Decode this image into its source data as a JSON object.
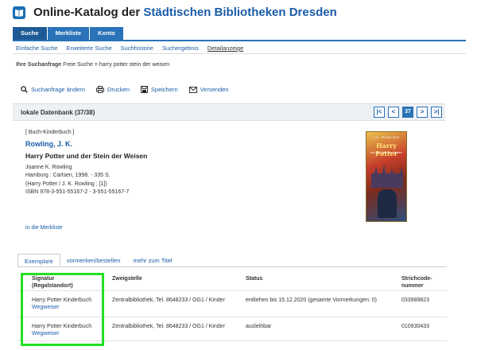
{
  "header": {
    "title_prefix": "Online-Katalog der",
    "title_accent": "Städtischen Bibliotheken Dresden",
    "logo_icon": "book-icon"
  },
  "main_tabs": [
    {
      "label": "Suche",
      "active": true
    },
    {
      "label": "Merkliste",
      "active": false
    },
    {
      "label": "Konto",
      "active": false
    }
  ],
  "sub_nav": [
    {
      "label": "Einfache Suche",
      "active": false
    },
    {
      "label": "Erweiterte Suche",
      "active": false
    },
    {
      "label": "Suchhistorie",
      "active": false
    },
    {
      "label": "Suchergebnis",
      "active": false
    },
    {
      "label": "Detailanzeige",
      "active": true
    }
  ],
  "query": {
    "label": "Ihre Suchanfrage",
    "value": "Freie Suche = harry potter stein der weisen"
  },
  "actions": [
    {
      "label": "Suchanfrage ändern",
      "icon": "search-icon"
    },
    {
      "label": "Drucken",
      "icon": "print-icon"
    },
    {
      "label": "Speichern",
      "icon": "save-icon"
    },
    {
      "label": "Versenden",
      "icon": "mail-icon"
    }
  ],
  "result_bar": {
    "count_label": "lokale Datenbank (37/38)",
    "current_page": "37",
    "pager_icons": [
      "first-page-icon",
      "prev-page-icon",
      "next-page-icon",
      "last-page-icon"
    ]
  },
  "record": {
    "type": "[ Buch-Kinderbuch ]",
    "author": "Rowling, J. K.",
    "title": "Harry Potter und der Stein der Weisen",
    "statement": "Joanne K. Rowling",
    "publication": "Hamburg : Carlsen, 1998. - 335 S.",
    "series": "(Harry Potter / J. K. Rowling ; [1])",
    "isbn": "ISBN 978-3-551-55167-2 - 3-551-55167-7",
    "merkliste_link": "in die Merkliste"
  },
  "cover": {
    "author": "J.K. ROWLING",
    "title": "Harry Potter",
    "subtitle": "und der Stein der Weisen"
  },
  "detail_tabs": [
    {
      "label": "Exemplare",
      "active": true
    },
    {
      "label": "vormerken/bestellen",
      "active": false
    },
    {
      "label": "mehr zum Titel",
      "active": false
    }
  ],
  "copies_table": {
    "headers": {
      "signatur_line1": "Signatur",
      "signatur_line2": "(Regalstandort)",
      "zweigstelle": "Zweigstelle",
      "status": "Status",
      "strichcode_line1": "Strichcode-",
      "strichcode_line2": "nummer"
    },
    "rows": [
      {
        "signatur": "Harry Potter Kinderbuch",
        "wegweiser": "Wegweiser",
        "zweigstelle": "Zentralbibliothek, Tel. 8648233 / OG1 / Kinder",
        "status": "entliehen bis 15.12.2020 (gesamte Vormerkungen: 0)",
        "strichcode": "033989823"
      },
      {
        "signatur": "Harry Potter Kinderbuch",
        "wegweiser": "Wegweiser",
        "zweigstelle": "Zentralbibliothek, Tel. 8648233 / OG1 / Kinder",
        "status": "ausleihbar",
        "strichcode": "010930433"
      }
    ]
  },
  "colors": {
    "brand_blue": "#2a73b8",
    "link_blue": "#1a5ca8",
    "highlight_green": "#22e022"
  }
}
